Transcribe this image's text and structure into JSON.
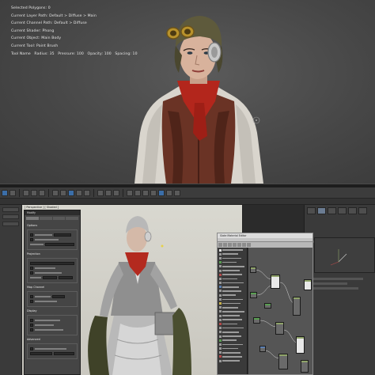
{
  "top_viewport": {
    "info_lines": [
      "Selected Polygons: 0",
      "Current Layer Path: Default > Diffuse > Main",
      "Current Channel Path: Default > Diffuse",
      "Current Shader: Phong",
      "Current Object: Main Body",
      "Current Tool: Paint Brush"
    ],
    "status_items": [
      "Tool Name",
      "Radius: 35",
      "Pressure: 100",
      "Opacity: 100",
      "Spacing: 10"
    ]
  },
  "app": {
    "toolbar_labels": [
      "Undo",
      "Redo",
      "Link",
      "Select",
      "Move",
      "Rotate",
      "Scale"
    ]
  },
  "bottom_viewport": {
    "label": "[ Perspective ] [ Shaded ]"
  },
  "rollout_panel": {
    "title": "Modify",
    "headings": [
      "Options",
      "Projection",
      "Map Channel",
      "Display",
      "Advanced"
    ]
  },
  "slate_window": {
    "title": "Slate Material Editor"
  },
  "colors": {
    "viewport_bg": "#474747",
    "viewport_light": "#d9d8d0",
    "panel_bg": "#454545",
    "accent_blue": "#3b6ea8",
    "node_green": "#8fa36a"
  }
}
